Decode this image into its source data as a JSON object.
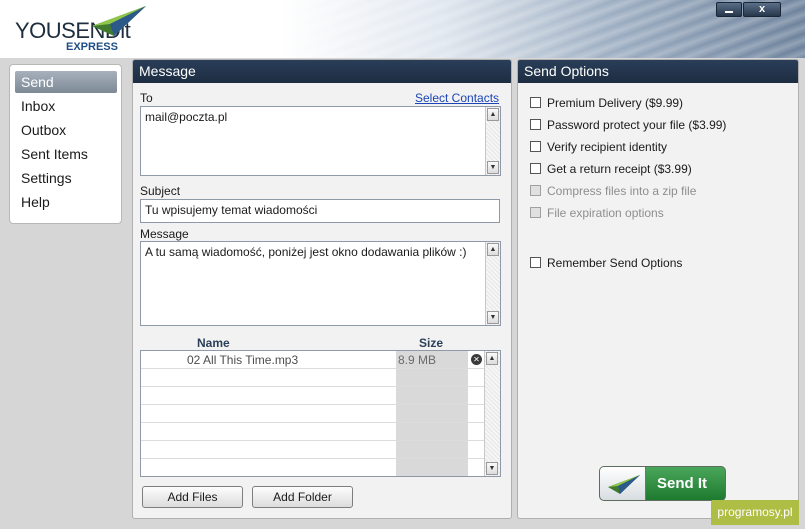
{
  "header": {
    "logo_main": "YOUSENDit",
    "logo_sub": "EXPRESS",
    "minimize_label": "",
    "close_label": "x"
  },
  "sidebar": {
    "items": [
      {
        "label": "Send",
        "active": true
      },
      {
        "label": "Inbox"
      },
      {
        "label": "Outbox"
      },
      {
        "label": "Sent Items"
      },
      {
        "label": "Settings"
      },
      {
        "label": "Help"
      }
    ]
  },
  "message_panel": {
    "title": "Message",
    "to_label": "To",
    "select_contacts": "Select Contacts",
    "to_value": "mail@poczta.pl",
    "subject_label": "Subject",
    "subject_value": "Tu wpisujemy temat wiadomości",
    "message_label": "Message",
    "message_value": "A tu samą wiadomość, poniżej jest okno dodawania plików :)",
    "files": {
      "columns": [
        "Name",
        "Size"
      ],
      "rows": [
        {
          "name": "02 All This Time.mp3",
          "size": "8.9 MB"
        }
      ]
    },
    "add_files": "Add Files",
    "add_folder": "Add Folder"
  },
  "send_options": {
    "title": "Send Options",
    "options": [
      {
        "label": "Premium Delivery ($9.99)",
        "checked": false,
        "enabled": true
      },
      {
        "label": "Password protect your file ($3.99)",
        "checked": false,
        "enabled": true
      },
      {
        "label": "Verify recipient identity",
        "checked": false,
        "enabled": true
      },
      {
        "label": "Get a return receipt ($3.99)",
        "checked": false,
        "enabled": true
      },
      {
        "label": "Compress files into a zip file",
        "checked": false,
        "enabled": false
      },
      {
        "label": "File expiration options",
        "checked": false,
        "enabled": false
      }
    ],
    "remember": "Remember Send Options"
  },
  "send_button": "Send It",
  "watermark": "programosy.pl",
  "colors": {
    "title_bar": "#1d2d42",
    "send_green": "#2e8f42",
    "link_blue": "#1b45b6",
    "watermark": "#aebd43"
  }
}
